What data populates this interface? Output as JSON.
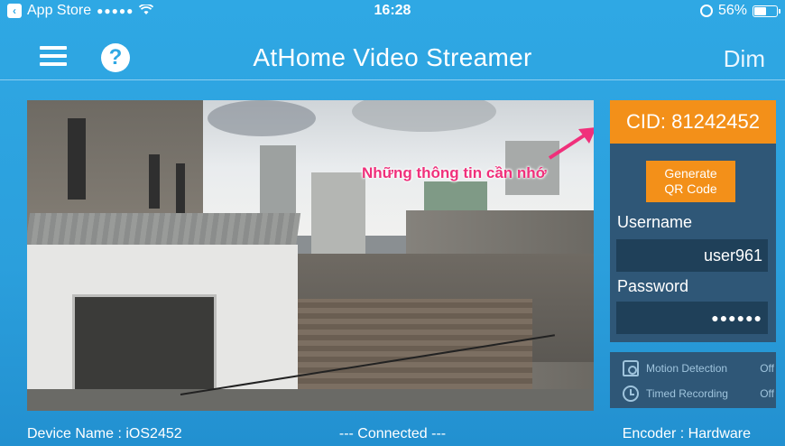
{
  "status_bar": {
    "back_app": "App Store",
    "signal": "●●●●●",
    "time": "16:28",
    "battery": "56%",
    "battery_level": 0.56
  },
  "nav": {
    "title": "AtHome Video Streamer",
    "dim_label": "Dim"
  },
  "video": {
    "annotation": "Những thông tin cần nhớ"
  },
  "panel": {
    "cid": "CID: 81242452",
    "qr_button": [
      "Generate",
      "QR Code"
    ],
    "username_label": "Username",
    "username_value": "user961",
    "password_label": "Password",
    "password_value": "●●●●●●"
  },
  "features": [
    {
      "label": "Motion Detection",
      "value": "Off",
      "icon": "motion-detection-icon"
    },
    {
      "label": "Timed Recording",
      "value": "Off",
      "icon": "clock-icon"
    }
  ],
  "bottom_bar": {
    "device_name": "Device Name : iOS2452",
    "connection": "--- Connected ---",
    "encoder": "Encoder : Hardware"
  },
  "colors": {
    "background": "#2fa8e4",
    "accent_orange": "#f39019",
    "panel": "#2f5777",
    "annotation": "#f0307b"
  }
}
